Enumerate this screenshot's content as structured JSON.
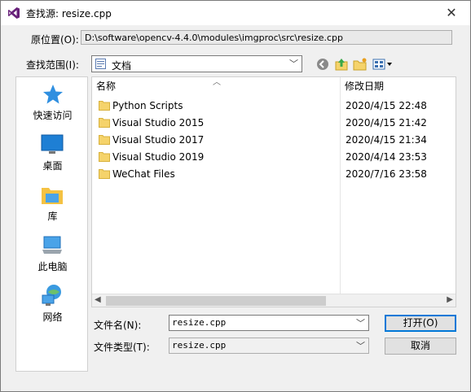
{
  "title": "查找源: resize.cpp",
  "close_glyph": "✕",
  "original_location": {
    "label": "原位置(O):",
    "value": "D:\\software\\opencv-4.4.0\\modules\\imgproc\\src\\resize.cpp"
  },
  "look_in": {
    "label": "查找范围(I):",
    "value": "文档"
  },
  "places": [
    {
      "label": "快速访问",
      "icon": "quick-access-star-icon"
    },
    {
      "label": "桌面",
      "icon": "desktop-icon"
    },
    {
      "label": "库",
      "icon": "library-icon"
    },
    {
      "label": "此电脑",
      "icon": "this-pc-icon"
    },
    {
      "label": "网络",
      "icon": "network-icon"
    }
  ],
  "columns": {
    "name": "名称",
    "date": "修改日期"
  },
  "files": [
    {
      "name": "Python Scripts",
      "date": "2020/4/15 22:48"
    },
    {
      "name": "Visual Studio 2015",
      "date": "2020/4/15 21:42"
    },
    {
      "name": "Visual Studio 2017",
      "date": "2020/4/15 21:34"
    },
    {
      "name": "Visual Studio 2019",
      "date": "2020/4/14 23:53"
    },
    {
      "name": "WeChat Files",
      "date": "2020/7/16 23:58"
    }
  ],
  "filename": {
    "label": "文件名(N):",
    "value": "resize.cpp"
  },
  "filetype": {
    "label": "文件类型(T):",
    "value": "resize.cpp"
  },
  "buttons": {
    "open": "打开(O)",
    "cancel": "取消"
  },
  "colors": {
    "accent": "#0078d7",
    "folder": "#f5d36b",
    "vs_purple": "#68217a"
  }
}
